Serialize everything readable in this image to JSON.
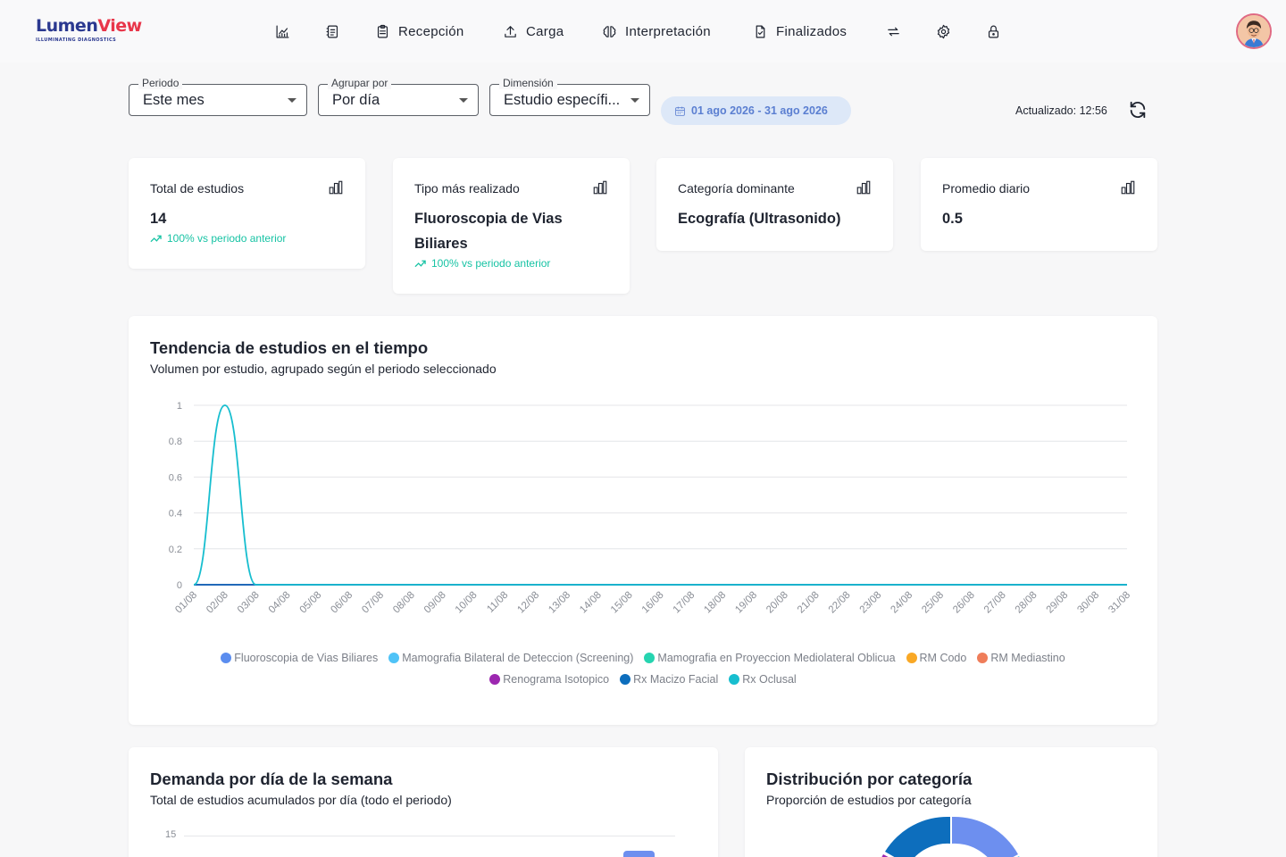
{
  "app": {
    "logo_part1": "Lumen",
    "logo_part2": "View",
    "tagline": "ILLUMINATING DIAGNOSTICS"
  },
  "nav": {
    "items": [
      {
        "label": "",
        "icon": "chart-line-icon"
      },
      {
        "label": "",
        "icon": "id-card-icon"
      },
      {
        "label": "Recepción",
        "icon": "clipboard-icon"
      },
      {
        "label": "Carga",
        "icon": "upload-icon"
      },
      {
        "label": "Interpretación",
        "icon": "brain-icon"
      },
      {
        "label": "Finalizados",
        "icon": "file-check-icon"
      },
      {
        "label": "",
        "icon": "swap-arrows-icon"
      },
      {
        "label": "",
        "icon": "gear-icon"
      },
      {
        "label": "",
        "icon": "lock-icon"
      }
    ]
  },
  "filters": {
    "periodo": {
      "label": "Periodo",
      "value": "Este mes"
    },
    "agrupar": {
      "label": "Agrupar por",
      "value": "Por día"
    },
    "dimension": {
      "label": "Dimensión",
      "value": "Estudio específi..."
    },
    "date_range": "01 ago 2026 - 31 ago 2026",
    "updated": "Actualizado: 12:56"
  },
  "kpis": [
    {
      "title": "Total de estudios",
      "value": "14",
      "delta": "100% vs periodo anterior"
    },
    {
      "title": "Tipo más realizado",
      "value": "Fluoroscopia de Vias Biliares",
      "delta": "100% vs periodo anterior"
    },
    {
      "title": "Categoría dominante",
      "value": "Ecografía (Ultrasonido)",
      "delta": ""
    },
    {
      "title": "Promedio diario",
      "value": "0.5",
      "delta": ""
    }
  ],
  "trend": {
    "title": "Tendencia de estudios en el tiempo",
    "subtitle": "Volumen por estudio, agrupado según el periodo seleccionado"
  },
  "weekday": {
    "title": "Demanda por día de la semana",
    "subtitle": "Total de estudios acumulados por día (todo el periodo)",
    "ytick_top": "15"
  },
  "category": {
    "title": "Distribución por categoría",
    "subtitle": "Proporción de estudios por categoría"
  },
  "chart_data": {
    "type": "line",
    "x": [
      "01/08",
      "02/08",
      "03/08",
      "04/08",
      "05/08",
      "06/08",
      "07/08",
      "08/08",
      "09/08",
      "10/08",
      "11/08",
      "12/08",
      "13/08",
      "14/08",
      "15/08",
      "16/08",
      "17/08",
      "18/08",
      "19/08",
      "20/08",
      "21/08",
      "22/08",
      "23/08",
      "24/08",
      "25/08",
      "26/08",
      "27/08",
      "28/08",
      "29/08",
      "30/08",
      "31/08"
    ],
    "yticks": [
      "0",
      "0.2",
      "0.4",
      "0.6",
      "0.8",
      "1"
    ],
    "ylim": [
      0,
      1
    ],
    "grid": true,
    "legend_position": "bottom",
    "series": [
      {
        "name": "Fluoroscopia de Vias Biliares",
        "color": "#5b8def",
        "values": [
          0,
          0,
          0,
          0,
          0,
          0,
          0,
          0,
          0,
          0,
          0,
          0,
          0,
          0,
          0,
          0,
          0,
          0,
          0,
          0,
          0,
          0,
          0,
          0,
          0,
          0,
          0,
          0,
          0,
          0,
          0
        ]
      },
      {
        "name": "Mamografia Bilateral de Deteccion (Screening)",
        "color": "#4fc3f7",
        "values": [
          0,
          0,
          0,
          0,
          0,
          0,
          0,
          0,
          0,
          0,
          0,
          0,
          0,
          0,
          0,
          0,
          0,
          0,
          0,
          0,
          0,
          0,
          0,
          0,
          0,
          0,
          0,
          0,
          0,
          0,
          0
        ]
      },
      {
        "name": "Mamografia en Proyeccion Mediolateral Oblicua",
        "color": "#26d4b0",
        "values": [
          0,
          0,
          0,
          0,
          0,
          0,
          0,
          0,
          0,
          0,
          0,
          0,
          0,
          0,
          0,
          0,
          0,
          0,
          0,
          0,
          0,
          0,
          0,
          0,
          0,
          0,
          0,
          0,
          0,
          0,
          0
        ]
      },
      {
        "name": "RM Codo",
        "color": "#f9a825",
        "values": [
          0,
          0,
          0,
          0,
          0,
          0,
          0,
          0,
          0,
          0,
          0,
          0,
          0,
          0,
          0,
          0,
          0,
          0,
          0,
          0,
          0,
          0,
          0,
          0,
          0,
          0,
          0,
          0,
          0,
          0,
          0
        ]
      },
      {
        "name": "RM Mediastino",
        "color": "#ef7d5a",
        "values": [
          0,
          0,
          0,
          0,
          0,
          0,
          0,
          0,
          0,
          0,
          0,
          0,
          0,
          0,
          0,
          0,
          0,
          0,
          0,
          0,
          0,
          0,
          0,
          0,
          0,
          0,
          0,
          0,
          0,
          0,
          0
        ]
      },
      {
        "name": "Renograma Isotopico",
        "color": "#9c27b0",
        "values": [
          0,
          0,
          0,
          0,
          0,
          0,
          0,
          0,
          0,
          0,
          0,
          0,
          0,
          0,
          0,
          0,
          0,
          0,
          0,
          0,
          0,
          0,
          0,
          0,
          0,
          0,
          0,
          0,
          0,
          0,
          0
        ]
      },
      {
        "name": "Rx Macizo Facial",
        "color": "#0d6ebd",
        "values": [
          0,
          0,
          0,
          0,
          0,
          0,
          0,
          0,
          0,
          0,
          0,
          0,
          0,
          0,
          0,
          0,
          0,
          0,
          0,
          0,
          0,
          0,
          0,
          0,
          0,
          0,
          0,
          0,
          0,
          0,
          0
        ]
      },
      {
        "name": "Rx Oclusal",
        "color": "#17becf",
        "values": [
          0,
          1,
          0,
          0,
          0,
          0,
          0,
          0,
          0,
          0,
          0,
          0,
          0,
          0,
          0,
          0,
          0,
          0,
          0,
          0,
          0,
          0,
          0,
          0,
          0,
          0,
          0,
          0,
          0,
          0,
          0
        ]
      }
    ]
  }
}
